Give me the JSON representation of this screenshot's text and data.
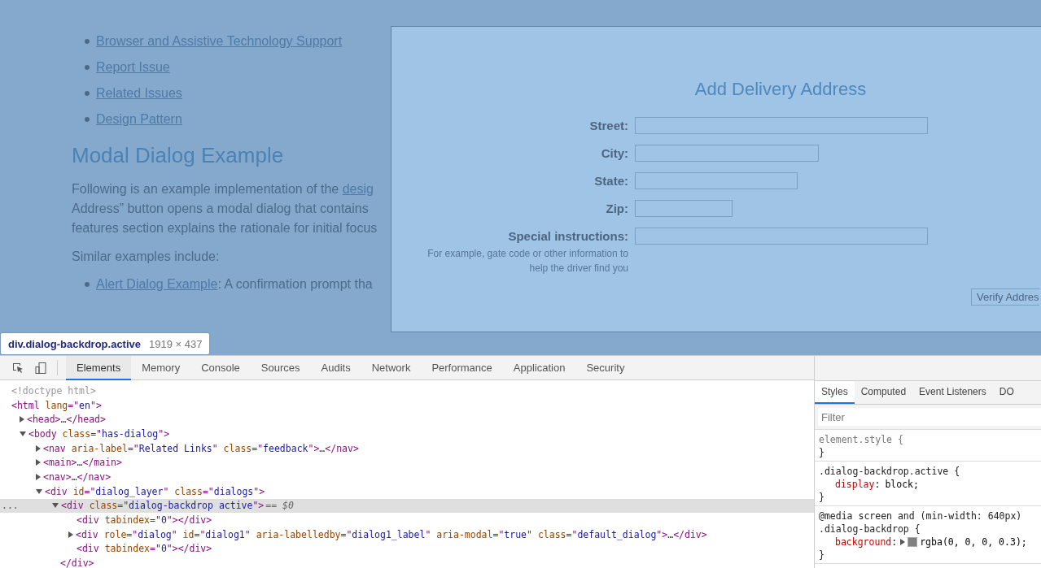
{
  "page": {
    "links": [
      "Browser and Assistive Technology Support",
      "Report Issue",
      "Related Issues",
      "Design Pattern"
    ],
    "heading": "Modal Dialog Example",
    "paragraph_lines": [
      {
        "text": "Following is an example implementation of the ",
        "link": "desig"
      },
      {
        "text": "Address” button opens a modal dialog that contains"
      },
      {
        "text": "features section explains the rationale for initial focus"
      }
    ],
    "similar_intro": "Similar examples include:",
    "similar": [
      {
        "link": "Alert Dialog Example",
        "text": ": A confirmation prompt tha"
      }
    ]
  },
  "dialog": {
    "title": "Add Delivery Address",
    "fields": [
      {
        "label": "Street:"
      },
      {
        "label": "City:"
      },
      {
        "label": "State:"
      },
      {
        "label": "Zip:"
      },
      {
        "label": "Special instructions:",
        "hint": "For example, gate code or other information to help the driver find you"
      }
    ],
    "button": "Verify Addres"
  },
  "inspect_tooltip": {
    "selector": "div.dialog-backdrop.active",
    "size": "1919 × 437"
  },
  "devtools": {
    "tabs": [
      {
        "label": "Elements",
        "selected": true
      },
      {
        "label": "Memory",
        "selected": false
      },
      {
        "label": "Console",
        "selected": false
      },
      {
        "label": "Sources",
        "selected": false
      },
      {
        "label": "Audits",
        "selected": false
      },
      {
        "label": "Network",
        "selected": false
      },
      {
        "label": "Performance",
        "selected": false
      },
      {
        "label": "Application",
        "selected": false
      },
      {
        "label": "Security",
        "selected": false
      }
    ],
    "dom": [
      {
        "parts": [
          {
            "kind": "comment",
            "text": "<!doctype html>"
          }
        ],
        "selected": false
      },
      {
        "parts": [
          {
            "kind": "tag",
            "text": "<html"
          },
          {
            "kind": "attr",
            "text": " lang"
          },
          {
            "kind": "tag",
            "text": "=\""
          },
          {
            "kind": "value",
            "text": "en"
          },
          {
            "kind": "tag",
            "text": "\">"
          }
        ],
        "selected": false,
        "children": [
          {
            "parts": [
              {
                "kind": "tag",
                "text": "<head>"
              },
              {
                "kind": "text",
                "text": "…"
              },
              {
                "kind": "tag",
                "text": "</head>"
              }
            ],
            "expanded": false,
            "selected": false
          },
          {
            "parts": [
              {
                "kind": "tag",
                "text": "<body"
              },
              {
                "kind": "attr",
                "text": " class"
              },
              {
                "kind": "tag",
                "text": "=\""
              },
              {
                "kind": "value",
                "text": "has-dialog"
              },
              {
                "kind": "tag",
                "text": "\">"
              }
            ],
            "expanded": true,
            "selected": false,
            "children": [
              {
                "parts": [
                  {
                    "kind": "tag",
                    "text": "<nav"
                  },
                  {
                    "kind": "attr",
                    "text": " aria-label"
                  },
                  {
                    "kind": "tag",
                    "text": "=\""
                  },
                  {
                    "kind": "value",
                    "text": "Related Links"
                  },
                  {
                    "kind": "tag",
                    "text": "\""
                  },
                  {
                    "kind": "attr",
                    "text": " class"
                  },
                  {
                    "kind": "tag",
                    "text": "=\""
                  },
                  {
                    "kind": "value",
                    "text": "feedback"
                  },
                  {
                    "kind": "tag",
                    "text": "\">"
                  },
                  {
                    "kind": "text",
                    "text": "…"
                  },
                  {
                    "kind": "tag",
                    "text": "</nav>"
                  }
                ],
                "expanded": false,
                "selected": false
              },
              {
                "parts": [
                  {
                    "kind": "tag",
                    "text": "<main>"
                  },
                  {
                    "kind": "text",
                    "text": "…"
                  },
                  {
                    "kind": "tag",
                    "text": "</main>"
                  }
                ],
                "expanded": false,
                "selected": false
              },
              {
                "parts": [
                  {
                    "kind": "tag",
                    "text": "<nav>"
                  },
                  {
                    "kind": "text",
                    "text": "…"
                  },
                  {
                    "kind": "tag",
                    "text": "</nav>"
                  }
                ],
                "expanded": false,
                "selected": false
              },
              {
                "parts": [
                  {
                    "kind": "tag",
                    "text": "<div"
                  },
                  {
                    "kind": "attr",
                    "text": " id"
                  },
                  {
                    "kind": "tag",
                    "text": "=\""
                  },
                  {
                    "kind": "value",
                    "text": "dialog_layer"
                  },
                  {
                    "kind": "tag",
                    "text": "\""
                  },
                  {
                    "kind": "attr",
                    "text": " class"
                  },
                  {
                    "kind": "tag",
                    "text": "=\""
                  },
                  {
                    "kind": "value",
                    "text": "dialogs"
                  },
                  {
                    "kind": "tag",
                    "text": "\">"
                  }
                ],
                "expanded": true,
                "selected": false,
                "children": [
                  {
                    "parts": [
                      {
                        "kind": "tag",
                        "text": "<div"
                      },
                      {
                        "kind": "attr",
                        "text": " class"
                      },
                      {
                        "kind": "tag",
                        "text": "=\""
                      },
                      {
                        "kind": "value",
                        "text": "dialog-backdrop active"
                      },
                      {
                        "kind": "tag",
                        "text": "\">"
                      }
                    ],
                    "expanded": true,
                    "selected": true,
                    "gutter": "...",
                    "marker": "== $0",
                    "closing": "</div>",
                    "children": [
                      {
                        "parts": [
                          {
                            "kind": "tag",
                            "text": "<div"
                          },
                          {
                            "kind": "attr",
                            "text": " tabindex"
                          },
                          {
                            "kind": "tag",
                            "text": "=\""
                          },
                          {
                            "kind": "value",
                            "text": "0"
                          },
                          {
                            "kind": "tag",
                            "text": "\"></div>"
                          }
                        ],
                        "selected": false
                      },
                      {
                        "parts": [
                          {
                            "kind": "tag",
                            "text": "<div"
                          },
                          {
                            "kind": "attr",
                            "text": " role"
                          },
                          {
                            "kind": "tag",
                            "text": "=\""
                          },
                          {
                            "kind": "value",
                            "text": "dialog"
                          },
                          {
                            "kind": "tag",
                            "text": "\""
                          },
                          {
                            "kind": "attr",
                            "text": " id"
                          },
                          {
                            "kind": "tag",
                            "text": "=\""
                          },
                          {
                            "kind": "value",
                            "text": "dialog1"
                          },
                          {
                            "kind": "tag",
                            "text": "\""
                          },
                          {
                            "kind": "attr",
                            "text": " aria-labelledby"
                          },
                          {
                            "kind": "tag",
                            "text": "=\""
                          },
                          {
                            "kind": "value",
                            "text": "dialog1_label"
                          },
                          {
                            "kind": "tag",
                            "text": "\""
                          },
                          {
                            "kind": "attr",
                            "text": " aria-modal"
                          },
                          {
                            "kind": "tag",
                            "text": "=\""
                          },
                          {
                            "kind": "value",
                            "text": "true"
                          },
                          {
                            "kind": "tag",
                            "text": "\""
                          },
                          {
                            "kind": "attr",
                            "text": " class"
                          },
                          {
                            "kind": "tag",
                            "text": "=\""
                          },
                          {
                            "kind": "value",
                            "text": "default_dialog"
                          },
                          {
                            "kind": "tag",
                            "text": "\">"
                          },
                          {
                            "kind": "text",
                            "text": "…"
                          },
                          {
                            "kind": "tag",
                            "text": "</div>"
                          }
                        ],
                        "expanded": false,
                        "selected": false
                      },
                      {
                        "parts": [
                          {
                            "kind": "tag",
                            "text": "<div"
                          },
                          {
                            "kind": "attr",
                            "text": " tabindex"
                          },
                          {
                            "kind": "tag",
                            "text": "=\""
                          },
                          {
                            "kind": "value",
                            "text": "0"
                          },
                          {
                            "kind": "tag",
                            "text": "\"></div>"
                          }
                        ],
                        "selected": false
                      }
                    ]
                  }
                ]
              }
            ]
          }
        ]
      }
    ],
    "side_tabs": [
      {
        "label": "Styles",
        "selected": true
      },
      {
        "label": "Computed",
        "selected": false
      },
      {
        "label": "Event Listeners",
        "selected": false
      },
      {
        "label": "DO",
        "selected": false
      }
    ],
    "filter_placeholder": "Filter",
    "rules": [
      {
        "selector": "element.style {",
        "kind": "inline",
        "closing": "}"
      },
      {
        "selector": ".dialog-backdrop.active {",
        "closing": "}",
        "declarations": [
          {
            "kind": "plain",
            "property": "display",
            "separator": ":",
            "value": "block;"
          }
        ]
      },
      {
        "media": "@media screen and (min-width: 640px)",
        "selector": ".dialog-backdrop {",
        "closing": "}",
        "declarations": [
          {
            "kind": "color",
            "property": "background",
            "separator": ":",
            "value": "rgba(0, 0, 0, 0.3);"
          }
        ]
      }
    ]
  }
}
